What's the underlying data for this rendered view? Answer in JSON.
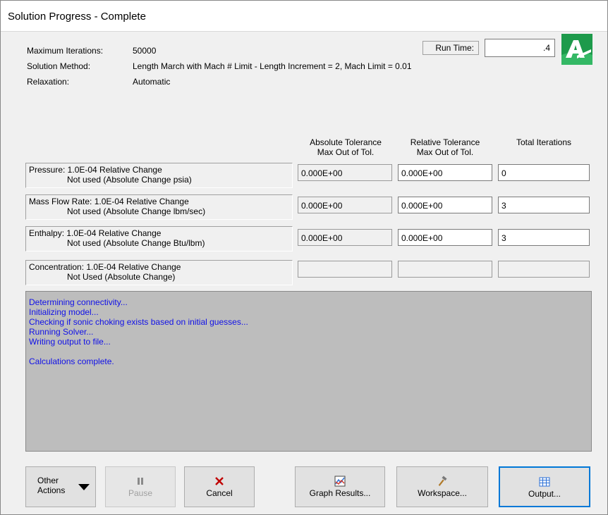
{
  "window": {
    "title": "Solution Progress - Complete"
  },
  "info": {
    "max_iterations_label": "Maximum Iterations:",
    "max_iterations_value": "50000",
    "solution_method_label": "Solution Method:",
    "solution_method_value": "Length March with Mach # Limit - Length Increment = 2, Mach Limit = 0.01",
    "relaxation_label": "Relaxation:",
    "relaxation_value": "Automatic",
    "run_time_label": "Run Time:",
    "run_time_value": ".4"
  },
  "columns": {
    "abs_line1": "Absolute Tolerance",
    "abs_line2": "Max Out of Tol.",
    "rel_line1": "Relative Tolerance",
    "rel_line2": "Max Out of Tol.",
    "total": "Total Iterations"
  },
  "rows": [
    {
      "line1": "Pressure: 1.0E-04 Relative Change",
      "line2": "Not used (Absolute Change psia)",
      "abs": "0.000E+00",
      "rel": "0.000E+00",
      "total": "0"
    },
    {
      "line1": "Mass Flow Rate: 1.0E-04 Relative Change",
      "line2": "Not used (Absolute Change lbm/sec)",
      "abs": "0.000E+00",
      "rel": "0.000E+00",
      "total": "3"
    },
    {
      "line1": "Enthalpy: 1.0E-04 Relative Change",
      "line2": "Not used (Absolute Change Btu/lbm)",
      "abs": "0.000E+00",
      "rel": "0.000E+00",
      "total": "3"
    },
    {
      "line1": "Concentration: 1.0E-04 Relative Change",
      "line2": "Not Used (Absolute Change)",
      "abs": "",
      "rel": "",
      "total": ""
    }
  ],
  "log": [
    "Determining connectivity...",
    "Initializing model...",
    "Checking if sonic choking exists based on initial guesses...",
    "Running Solver...",
    "Writing output to file...",
    "",
    "Calculations complete."
  ],
  "buttons": {
    "other_actions": "Other Actions",
    "other_line1": "Other",
    "other_line2": "Actions",
    "pause": "Pause",
    "cancel": "Cancel",
    "graph": "Graph Results...",
    "workspace": "Workspace...",
    "output": "Output..."
  },
  "icons": {
    "pause": "pause-icon",
    "cancel": "red-x-icon",
    "graph": "graph-icon",
    "workspace": "hammer-icon",
    "output": "table-icon",
    "logo": "app-logo-icon"
  },
  "colors": {
    "log_text": "#1010e8",
    "log_background": "#bdbdbd",
    "cancel_icon": "#c00000",
    "focus_border": "#0078d7",
    "logo_green": "#1d9a4b"
  }
}
